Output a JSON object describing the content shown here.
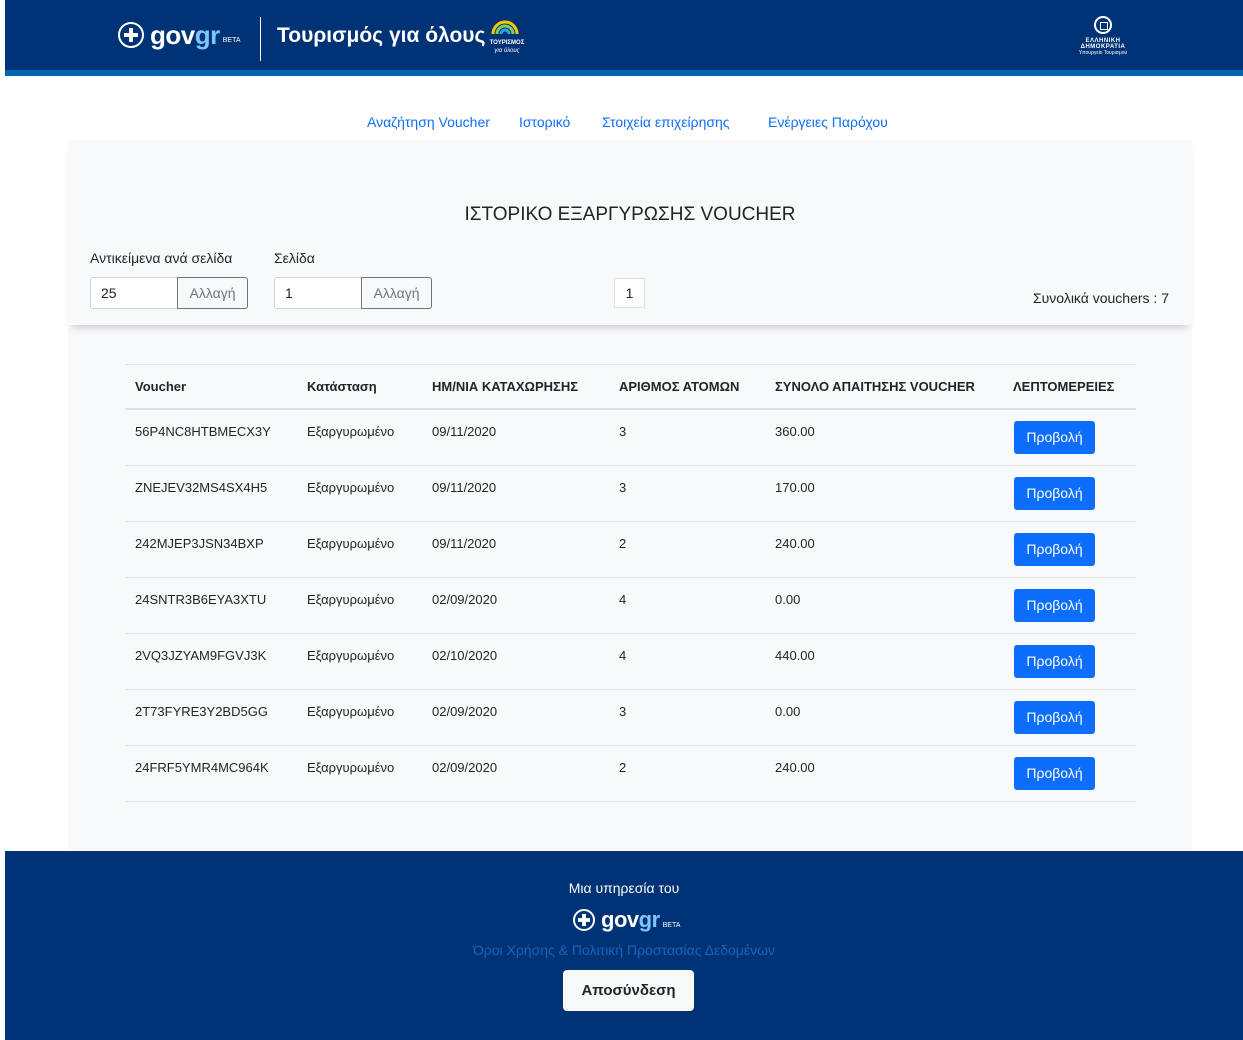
{
  "header": {
    "gov_logo": "gov",
    "gov_logo_accent": "gr",
    "gov_logo_badge": "BETA",
    "app_title": "Τουρισμός για όλους",
    "tourism_logo_line1": "ΤΟΥΡΙΣΜΟΣ",
    "tourism_logo_line2": "για όλους",
    "republic_line1": "ΕΛΛΗΝΙΚΗ ΔΗΜΟΚΡΑΤΙΑ",
    "republic_line2": "Υπουργείο Τουρισμού"
  },
  "nav": {
    "items": [
      {
        "label": "Αναζήτηση Voucher"
      },
      {
        "label": "Ιστορικό"
      },
      {
        "label": "Στοιχεία επιχείρησης"
      },
      {
        "label": "Ενέργειες Παρόχου"
      }
    ]
  },
  "page": {
    "title": "ΙΣΤΟΡΙΚΟ ΕΞΑΡΓΥΡΩΣΗΣ VOUCHER",
    "per_page_label": "Αντικείμενα ανά σελίδα",
    "per_page_value": "25",
    "page_label": "Σελίδα",
    "page_value": "1",
    "change_label": "Αλλαγή",
    "current_page": "1",
    "total_vouchers": "Συνολικά vouchers : 7"
  },
  "table": {
    "headers": [
      "Voucher",
      "Κατάσταση",
      "ΗΜ/ΝΙΑ ΚΑΤΑΧΩΡΗΣΗΣ",
      "ΑΡΙΘΜΟΣ ΑΤΟΜΩΝ",
      "ΣΥΝΟΛΟ ΑΠΑΙΤΗΣΗΣ VOUCHER",
      "ΛΕΠΤΟΜΕΡΕΙΕΣ"
    ],
    "view_label": "Προβολή",
    "rows": [
      {
        "voucher": "56P4NC8HTBMECX3Y",
        "status": "Εξαργυρωμένο",
        "date": "09/11/2020",
        "people": "3",
        "total": "360.00"
      },
      {
        "voucher": "ZNEJEV32MS4SX4H5",
        "status": "Εξαργυρωμένο",
        "date": "09/11/2020",
        "people": "3",
        "total": "170.00"
      },
      {
        "voucher": "242MJEP3JSN34BXP",
        "status": "Εξαργυρωμένο",
        "date": "09/11/2020",
        "people": "2",
        "total": "240.00"
      },
      {
        "voucher": "24SNTR3B6EYA3XTU",
        "status": "Εξαργυρωμένο",
        "date": "02/09/2020",
        "people": "4",
        "total": "0.00"
      },
      {
        "voucher": "2VQ3JZYAM9FGVJ3K",
        "status": "Εξαργυρωμένο",
        "date": "02/10/2020",
        "people": "4",
        "total": "440.00"
      },
      {
        "voucher": "2T73FYRE3Y2BD5GG",
        "status": "Εξαργυρωμένο",
        "date": "02/09/2020",
        "people": "3",
        "total": "0.00"
      },
      {
        "voucher": "24FRF5YMR4MC964K",
        "status": "Εξαργυρωμένο",
        "date": "02/09/2020",
        "people": "2",
        "total": "240.00"
      }
    ]
  },
  "footer": {
    "service_of": "Μια υπηρεσία του",
    "terms_link": "Όροι Χρήσης & Πολιτική Προστασίας Δεδομένων",
    "logout_label": "Αποσύνδεση"
  },
  "colors": {
    "header_bg": "#003375",
    "accent": "#0d6efd",
    "panel_bg": "#f8f9fa"
  }
}
